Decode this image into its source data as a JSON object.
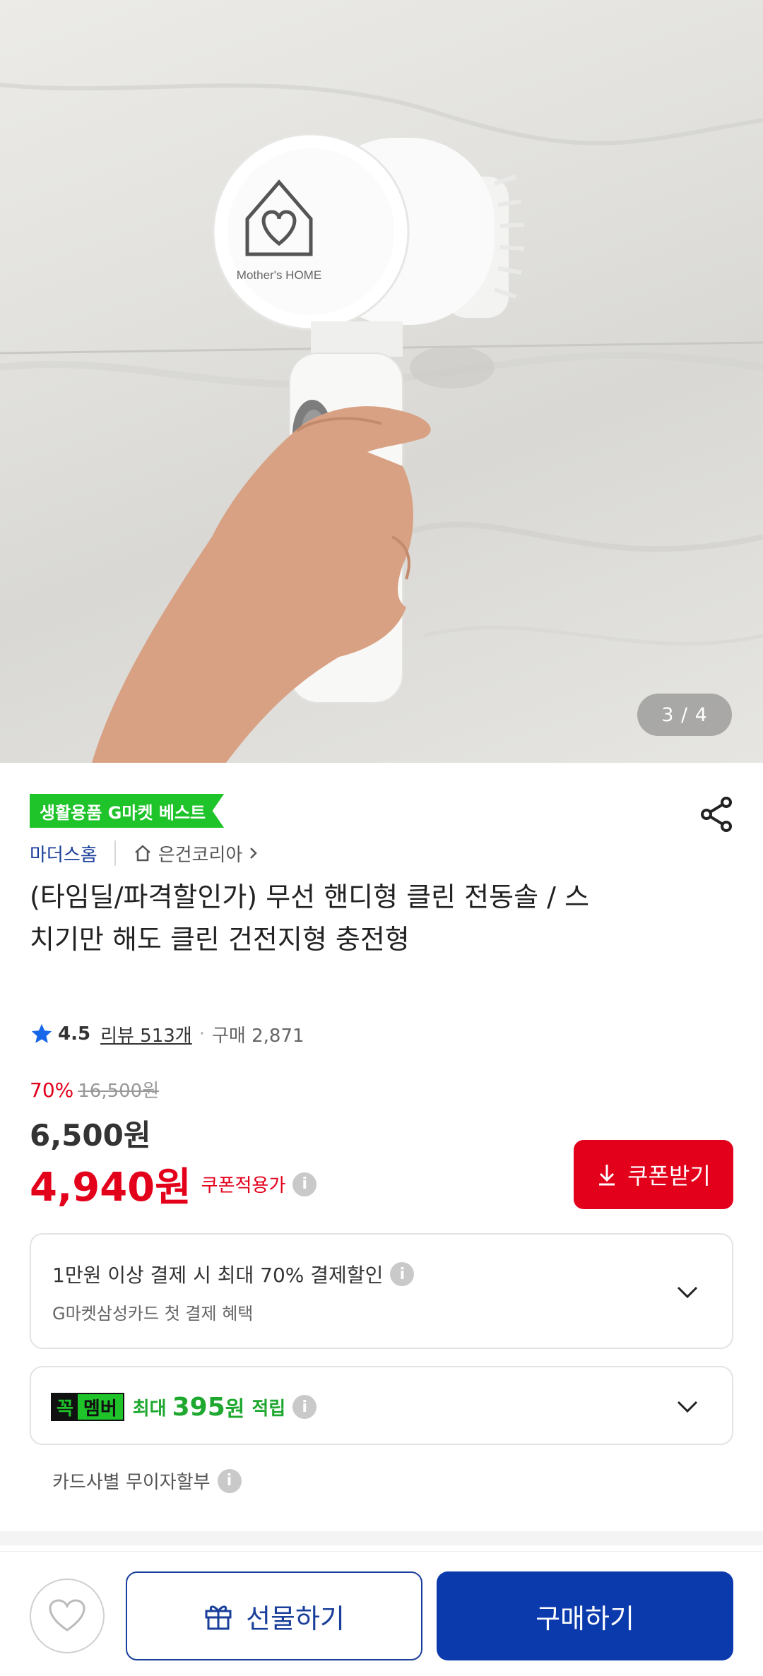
{
  "hero": {
    "product_brand_text": "Mother's HOME",
    "image_counter": "3 / 4"
  },
  "product": {
    "badge": "생활용품 G마켓 베스트",
    "brand": "마더스홈",
    "seller": "은건코리아",
    "title": "(타임딜/파격할인가) 무선 핸디형 클린 전동솔 / 스치기만 해도 클린 건전지형 충전형",
    "rating": "4.5",
    "review_label": "리뷰 513개",
    "purchase_label": "구매 2,871"
  },
  "price": {
    "discount_rate": "70%",
    "original_price": "16,500원",
    "sale_price": "6,500원",
    "coupon_price": "4,940원",
    "coupon_label": "쿠폰적용가",
    "coupon_button": "쿠폰받기"
  },
  "benefits": {
    "card_discount": "1만원 이상 결제 시 최대  70% 결제할인",
    "card_sub": "G마켓삼성카드 첫 결제 혜택",
    "member_logo_a": "꼭",
    "member_logo_b": "멤버",
    "member_max": "최대",
    "member_points": "395",
    "member_points_unit": "원",
    "member_earn": "적립",
    "installment": "카드사별 무이자할부"
  },
  "actions": {
    "gift_button": "선물하기",
    "buy_button": "구매하기"
  },
  "icons": {
    "star": "star-icon",
    "share": "share-icon",
    "home": "home-icon",
    "info": "info-icon",
    "chevron": "chevron-down-icon",
    "download": "download-icon",
    "heart": "heart-icon",
    "gift": "gift-icon"
  },
  "colors": {
    "accent_red": "#e3001b",
    "brand_blue": "#0b3aad",
    "best_green": "#1fc32a"
  }
}
